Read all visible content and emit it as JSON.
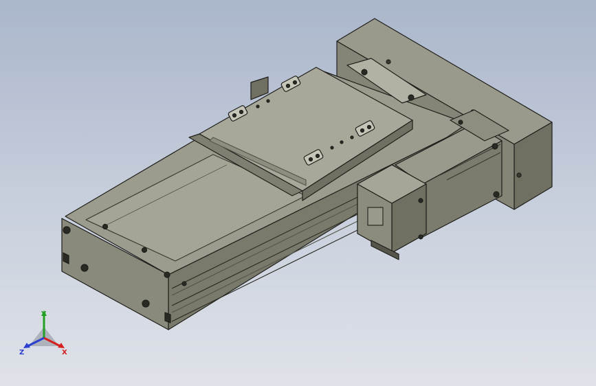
{
  "viewport": {
    "background_top": "#aab6cb",
    "background_bottom": "#dfe2e8"
  },
  "model": {
    "body_color": "#8e8e80",
    "edge_color": "#1e1e1a",
    "dark_face_color": "#6f6f62",
    "light_face_color": "#a4a496"
  },
  "triad": {
    "x_label": "X",
    "y_label": "Y",
    "z_label": "Z",
    "x_color": "#d42020",
    "y_color": "#22a022",
    "z_color": "#2a3fd0"
  }
}
